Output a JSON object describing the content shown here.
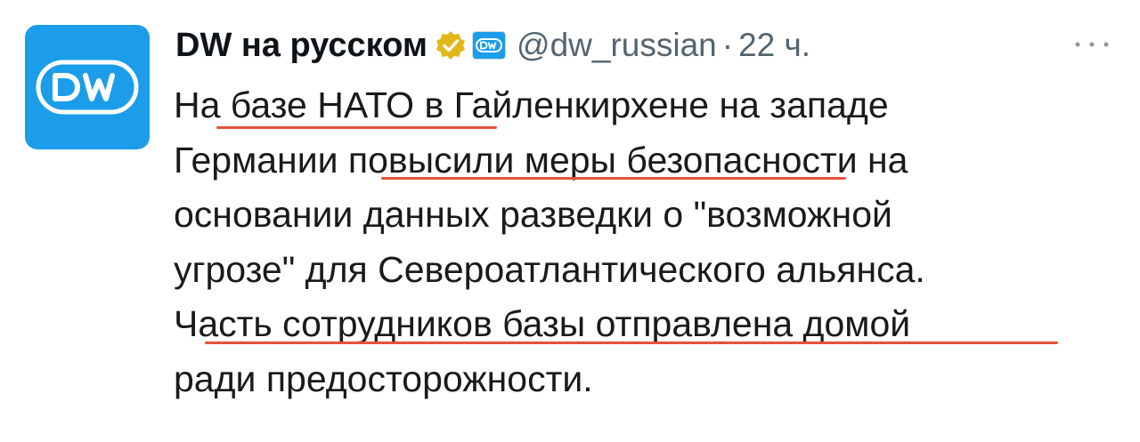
{
  "tweet": {
    "display_name": "DW на русском",
    "handle": "@dw_russian",
    "separator": "·",
    "time": "22 ч.",
    "body_lines": [
      "На базе НАТО в Гайленкирхене на западе",
      "Германии повысили меры безопасности на",
      "основании данных разведки о \"возможной",
      "угрозе\" для Североатлантического альянса.",
      "Часть сотрудников базы отправлена домой",
      "ради предосторожности."
    ]
  },
  "icons": {
    "avatar": "dw-logo-icon",
    "verified": "verified-badge-icon",
    "affiliation": "dw-affiliation-icon",
    "more": "more-options-icon"
  },
  "colors": {
    "avatar_bg": "#1c9dea",
    "verified_gold": "#e2b719",
    "secondary_text": "#536471",
    "underline": "#e5533a"
  }
}
